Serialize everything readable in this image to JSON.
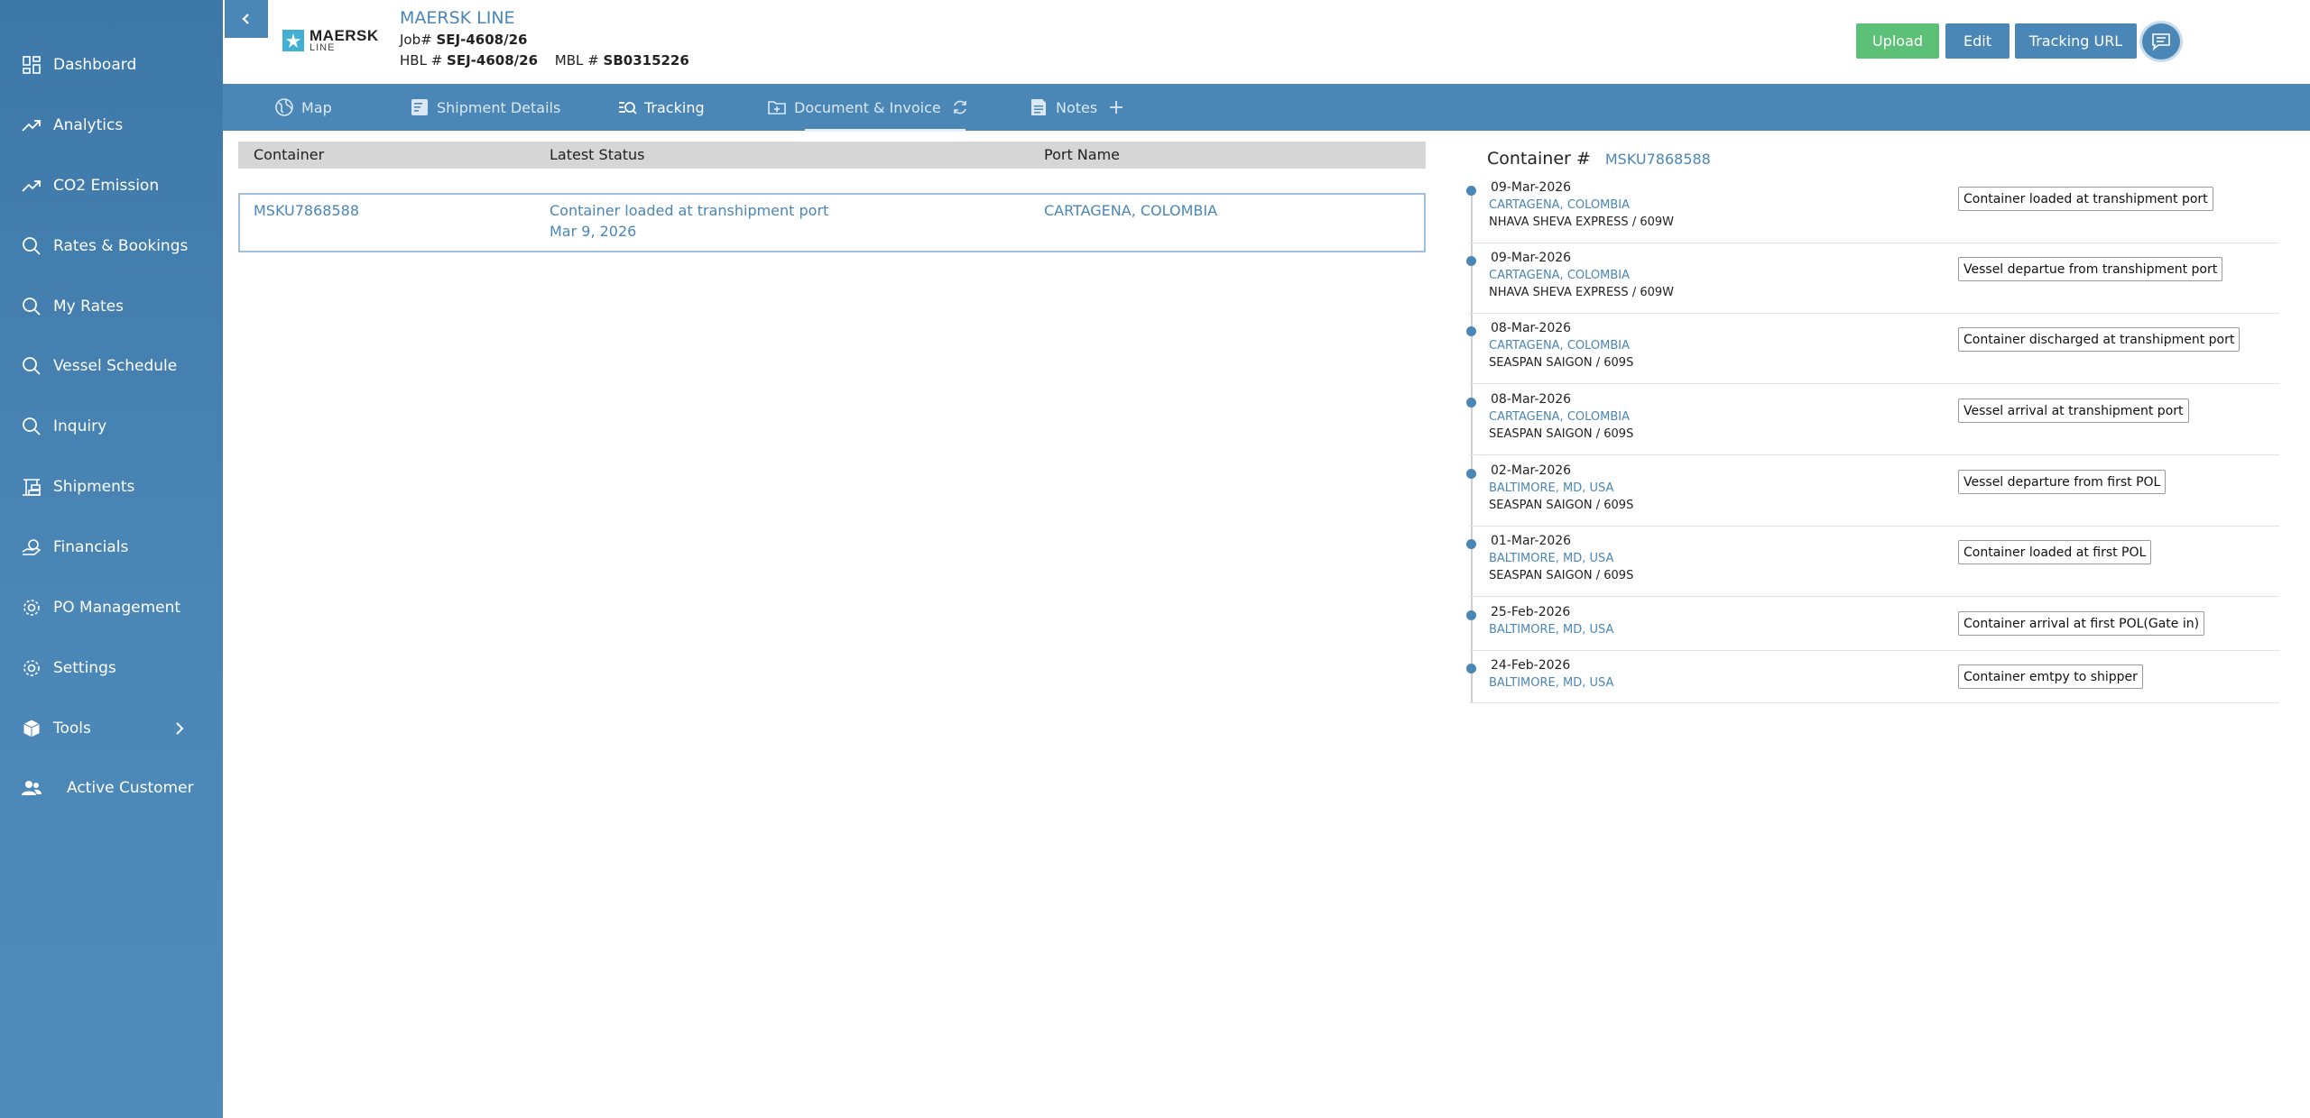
{
  "sidebar": {
    "items": [
      {
        "label": "Dashboard",
        "icon": "dashboard-icon"
      },
      {
        "label": "Analytics",
        "icon": "trend-icon"
      },
      {
        "label": "CO2 Emission",
        "icon": "trend-icon"
      },
      {
        "label": "Rates & Bookings",
        "icon": "search-icon"
      },
      {
        "label": "My Rates",
        "icon": "search-icon"
      },
      {
        "label": "Vessel Schedule",
        "icon": "search-icon"
      },
      {
        "label": "Inquiry",
        "icon": "search-icon"
      },
      {
        "label": "Shipments",
        "icon": "crane-icon"
      },
      {
        "label": "Financials",
        "icon": "money-icon"
      },
      {
        "label": "PO Management",
        "icon": "gear-icon"
      },
      {
        "label": "Settings",
        "icon": "gear-icon"
      },
      {
        "label": "Tools",
        "icon": "box-icon"
      },
      {
        "label": "Active Customer",
        "icon": "users-icon"
      }
    ]
  },
  "header": {
    "logo_line1": "MAERSK",
    "logo_line2": "LINE",
    "carrier": "MAERSK LINE",
    "job_label": "Job#",
    "job_value": "SEJ-4608/26",
    "hbl_label": "HBL #",
    "hbl_value": "SEJ-4608/26",
    "mbl_label": "MBL #",
    "mbl_value": "SB0315226",
    "upload_label": "Upload",
    "edit_label": "Edit",
    "tracking_url_label": "Tracking URL"
  },
  "tabs": {
    "map": "Map",
    "shipment_details": "Shipment Details",
    "tracking": "Tracking",
    "documents": "Document & Invoice",
    "notes": "Notes"
  },
  "table": {
    "headers": [
      "Container",
      "Latest Status",
      "Port Name"
    ],
    "row": {
      "container": "MSKU7868588",
      "status": "Container loaded at transhipment port",
      "status_date": "Mar 9, 2026",
      "port": "CARTAGENA, COLOMBIA"
    }
  },
  "timeline": {
    "title": "Container #",
    "container_no": "MSKU7868588",
    "events": [
      {
        "date": "09-Mar-2026",
        "port": "CARTAGENA, COLOMBIA",
        "vessel": "NHAVA SHEVA EXPRESS / 609W",
        "desc": "Container loaded at transhipment port"
      },
      {
        "date": "09-Mar-2026",
        "port": "CARTAGENA, COLOMBIA",
        "vessel": "NHAVA SHEVA EXPRESS / 609W",
        "desc": "Vessel departue from transhipment port"
      },
      {
        "date": "08-Mar-2026",
        "port": "CARTAGENA, COLOMBIA",
        "vessel": "SEASPAN SAIGON / 609S",
        "desc": "Container discharged at transhipment port"
      },
      {
        "date": "08-Mar-2026",
        "port": "CARTAGENA, COLOMBIA",
        "vessel": "SEASPAN SAIGON / 609S",
        "desc": "Vessel arrival at transhipment port"
      },
      {
        "date": "02-Mar-2026",
        "port": "BALTIMORE, MD, USA",
        "vessel": "SEASPAN SAIGON / 609S",
        "desc": "Vessel departure from first POL"
      },
      {
        "date": "01-Mar-2026",
        "port": "BALTIMORE, MD, USA",
        "vessel": "SEASPAN SAIGON / 609S",
        "desc": "Container loaded at first POL"
      },
      {
        "date": "25-Feb-2026",
        "port": "BALTIMORE, MD, USA",
        "vessel": "",
        "desc": "Container arrival at first POL(Gate in)"
      },
      {
        "date": "24-Feb-2026",
        "port": "BALTIMORE, MD, USA",
        "vessel": "",
        "desc": "Container emtpy to shipper"
      }
    ]
  },
  "colors": {
    "primary": "#4a86b6",
    "upload_green": "#5cc077",
    "table_header_bg": "#d6d6d6"
  }
}
